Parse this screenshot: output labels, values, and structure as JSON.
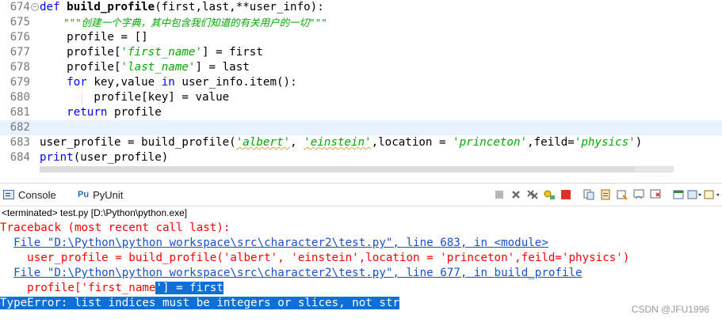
{
  "editor": {
    "lines": [
      {
        "num": "674",
        "folded": true
      },
      {
        "num": "675"
      },
      {
        "num": "676"
      },
      {
        "num": "677"
      },
      {
        "num": "678"
      },
      {
        "num": "679"
      },
      {
        "num": "680"
      },
      {
        "num": "681"
      },
      {
        "num": "682"
      },
      {
        "num": "683"
      },
      {
        "num": "684"
      }
    ],
    "fold_marker": "−",
    "code": {
      "l674_def": "def ",
      "l674_name": "build_profile",
      "l674_rest": "(first,last,**user_info):",
      "l675_doc": "    \"\"\"创建一个字典，其中包含我们知道的有关用户的一切\"\"\"",
      "l676": "    profile = []",
      "l677_a": "    profile[",
      "l677_str": "'first_name'",
      "l677_b": "] = first",
      "l678_a": "    profile[",
      "l678_str": "'last_name'",
      "l678_b": "] = last",
      "l679_for": "    for",
      "l679_a": " key,value ",
      "l679_in": "in",
      "l679_b": " user_info.item():",
      "l680": "        profile[key] = value",
      "l681_ret": "    return",
      "l681_b": " profile",
      "l682": "",
      "l683_a": "user_profile = build_profile(",
      "l683_s1": "'albert'",
      "l683_c1": ", ",
      "l683_s2": "'einstein'",
      "l683_c2": ",location = ",
      "l683_s3": "'princeton'",
      "l683_c3": ",feild=",
      "l683_s4": "'physics'",
      "l683_c4": ")",
      "l684_print": "print",
      "l684_b": "(user_profile)"
    }
  },
  "console_panel": {
    "tabs": [
      {
        "label": "Console"
      },
      {
        "label": "PyUnit"
      }
    ],
    "pyunit_glyph": "Pu",
    "toolbar_icons": [
      "stop-icon",
      "remove-launch-icon",
      "remove-all-icon",
      "pin-icon",
      "terminate-icon",
      "copy-icon",
      "paste-icon",
      "scroll-lock-icon",
      "word-wrap-icon",
      "clear-icon",
      "display-console-icon",
      "open-console-icon",
      "view-menu-icon"
    ],
    "status": "<terminated> test.py [D:\\Python\\python.exe]",
    "output": {
      "o1": "Traceback (most recent call last):",
      "o2_pre": "  ",
      "o2_link": "File \"D:\\Python\\python workspace\\src\\character2\\test.py\", line 683, in <module>",
      "o3": "    user_profile = build_profile('albert', 'einstein',location = 'princeton',feild='physics')",
      "o4_pre": "  ",
      "o4_link": "File \"D:\\Python\\python workspace\\src\\character2\\test.py\", line 677, in build_profile",
      "o5_a": "    profile['first_name",
      "o5_sel": "'] = first",
      "o6": "TypeError: list indices must be integers or slices, not str"
    }
  },
  "watermark": "CSDN @JFU1996",
  "colors": {
    "keyword": "#0000ff",
    "string": "#00aa00",
    "error": "#ff0000",
    "link": "#1a51cf",
    "selection": "#0f6fd6",
    "current_line": "#e8f2fe"
  }
}
